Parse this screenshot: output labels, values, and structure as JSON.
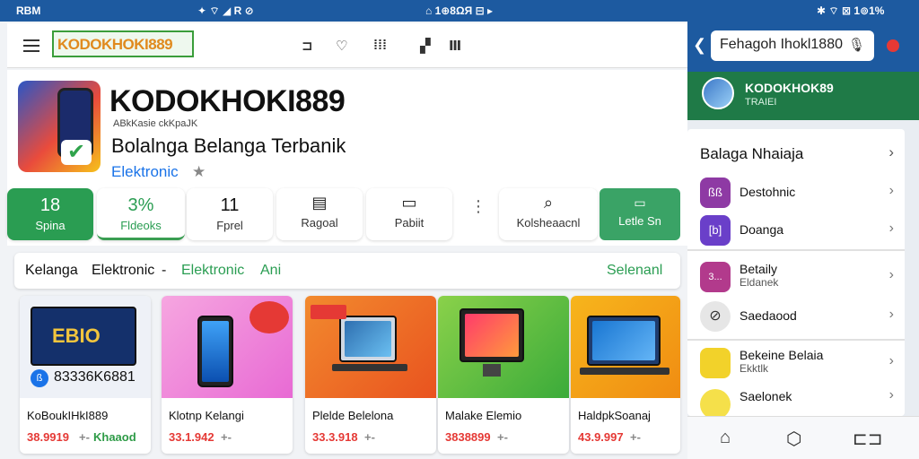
{
  "status_bar": {
    "left": "RBM",
    "left_icons": "✦ ⌔ ◢ R ⊘",
    "center": "⌂ 1⊕8ΩЯ ⊟ ▸",
    "right": "✱ ⌔ ⊠ 1⊚1%"
  },
  "top_bar": {
    "logo": "KODOKHOKI889",
    "icons": [
      "⊐",
      "♡",
      "⁞⁞⁞",
      "▞",
      "Ⅲ"
    ]
  },
  "app": {
    "title": "KODOKHOKI889",
    "small_label": "ABkKasie ckKpaJK",
    "subtitle": "Bolalnga Belanga Terbanik",
    "category": "Elektronic",
    "stats": [
      {
        "value": "18",
        "label": "Spina"
      },
      {
        "value": "3%",
        "label": "Fldeoks"
      },
      {
        "value": "11",
        "label": "Fprel"
      }
    ],
    "actions": [
      {
        "icon": "▤",
        "label": "Ragoal"
      },
      {
        "icon": "▭",
        "label": "Pabiit"
      },
      {
        "icon": "⌕",
        "label": "Kolsheaacnl"
      }
    ],
    "install_label": "Letle Sn",
    "install_icon": "▭"
  },
  "category_bar": {
    "label1": "Kelanga",
    "label2": "Elektronic",
    "sep": "-",
    "label3": "Elektronic",
    "label4": "Ani",
    "action": "Selenanl"
  },
  "products": [
    {
      "name": "KoBoukIHkI889",
      "price": "38.9919",
      "extra": "Khaaod",
      "extra_prefix": "+-",
      "badge_text": "83336K6881",
      "screen_text": "EBIO"
    },
    {
      "name": "Klotnp Kelangi",
      "price": "33.1.942",
      "extra": "",
      "extra_prefix": "+-",
      "badge_text": "",
      "screen_text": ""
    },
    {
      "name": "Plelde Belelona",
      "price": "33.3.918",
      "extra": "",
      "extra_prefix": "+-",
      "badge_text": "",
      "screen_text": ""
    },
    {
      "name": "Malake Elemio",
      "price": "3838899",
      "extra": "",
      "extra_prefix": "+-",
      "badge_text": "",
      "screen_text": ""
    },
    {
      "name": "HaldpkSoanaj",
      "price": "43.9.997",
      "extra": "",
      "extra_prefix": "+-",
      "badge_text": "",
      "screen_text": ""
    }
  ],
  "right_panel": {
    "search_value": "Fehagoh Ihokl1880",
    "account_name": "KODOKHOK89",
    "account_sub": "TRAIEI",
    "menu_title": "Balaga Nhaiaja",
    "menu_items": [
      {
        "label": "Destohnic",
        "sub": "",
        "icon_text": "ßß"
      },
      {
        "label": "Doanga",
        "sub": "",
        "icon_text": "[b]"
      },
      {
        "label": "Betaily",
        "sub": "Eldanek",
        "icon_text": "3..."
      },
      {
        "label": "Saedaood",
        "sub": "",
        "icon_text": "⊘"
      },
      {
        "label": "Bekeine Belaia",
        "sub": "Ekktlk",
        "icon_text": ""
      },
      {
        "label": "Saelonek",
        "sub": "",
        "icon_text": ""
      }
    ],
    "nav_icons": [
      "⌂",
      "⬡",
      "⊏⊐"
    ]
  }
}
